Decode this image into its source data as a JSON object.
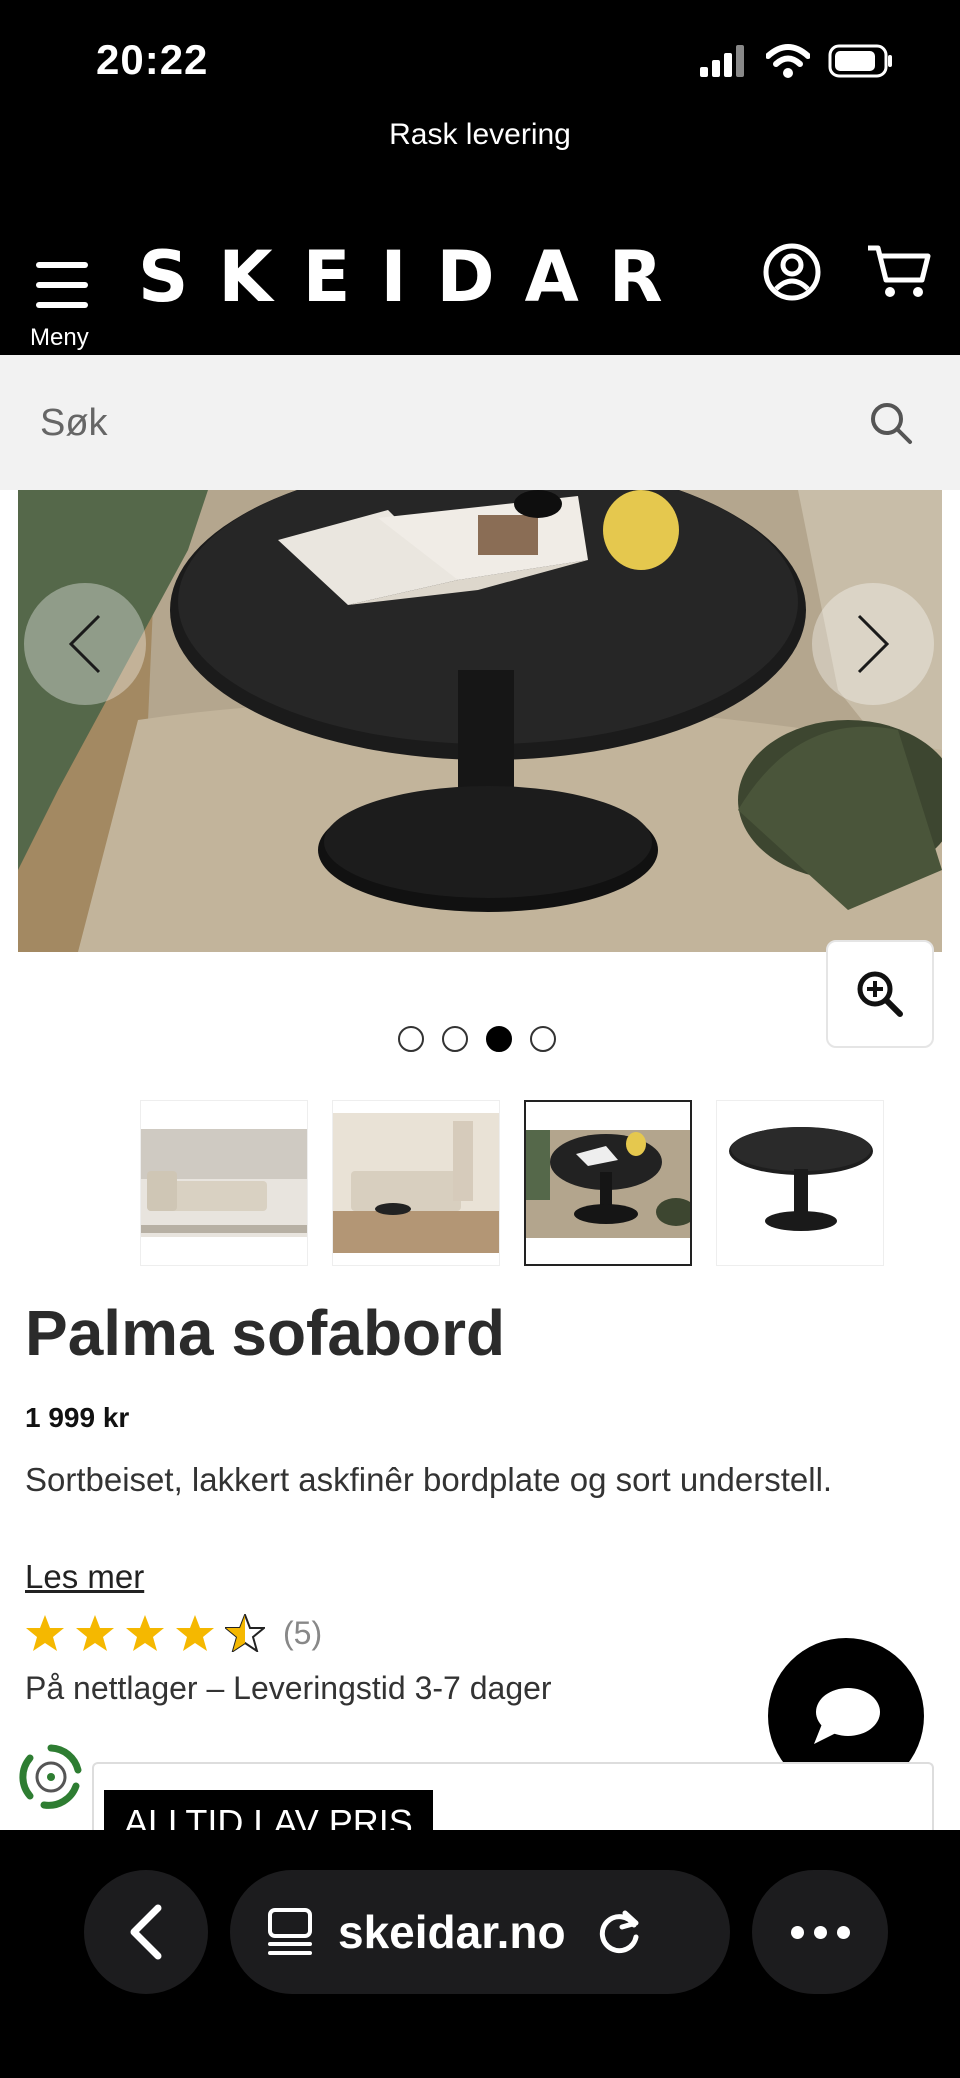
{
  "status": {
    "time": "20:22"
  },
  "promo": {
    "text": "Rask levering"
  },
  "header": {
    "logo": "SKEIDAR",
    "menu_label": "Meny"
  },
  "search": {
    "placeholder": "Søk",
    "value": ""
  },
  "gallery": {
    "dots": [
      false,
      false,
      true,
      false
    ],
    "active_index": 2,
    "thumbnails": [
      "sofa-livingroom",
      "sofa-room-angle",
      "table-lifestyle",
      "table-product"
    ]
  },
  "product": {
    "title": "Palma sofabord",
    "price": "1 999 kr",
    "description": "Sortbeiset, lakkert askfinêr bordplate og sort understell.",
    "read_more": "Les mer",
    "rating": 4.5,
    "rating_count": "(5)",
    "availability": "På nettlager – Leveringstid 3-7 dager",
    "promo_tag": "ALLTID LAV PRIS"
  },
  "browser": {
    "url": "skeidar.no"
  },
  "colors": {
    "header_bg": "#000000",
    "star": "#f5b800",
    "search_bg": "#f2f2f2",
    "eco": "#2e7d32"
  }
}
